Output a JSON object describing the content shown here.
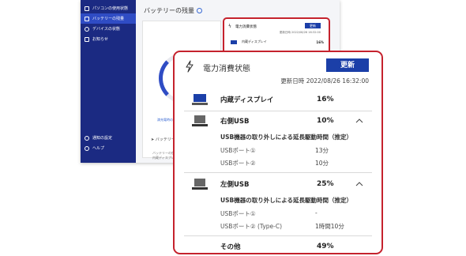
{
  "sidebar": {
    "items": [
      {
        "label": "パソコンの使用状態",
        "icon": "laptop-icon"
      },
      {
        "label": "バッテリーの残量",
        "icon": "battery-icon"
      },
      {
        "label": "デバイスの状態",
        "icon": "gear-icon"
      },
      {
        "label": "お知らせ",
        "icon": "news-icon"
      }
    ],
    "bottom_items": [
      {
        "label": "通知の設定",
        "icon": "settings-icon"
      },
      {
        "label": "ヘルプ",
        "icon": "help-icon"
      }
    ]
  },
  "background": {
    "title": "バッテリーの残量",
    "link": "満充電時の駆動時間",
    "section_title": "バッテリー",
    "rows": [
      "バッテリーの使用",
      "内蔵ディスプレイ"
    ]
  },
  "mini_card": {
    "title": "電力消費状態",
    "refresh_label": "更新",
    "updated": "更新日時 2022/08/26 16:32:00",
    "row_label": "内蔵ディスプレイ",
    "row_value": "16%"
  },
  "panel": {
    "title": "電力消費状態",
    "refresh_label": "更新",
    "updated": "更新日時 2022/08/26 16:32:00",
    "accent_color": "#1b3fa8",
    "highlight_color": "#c5222d",
    "devices": [
      {
        "label": "内蔵ディスプレイ",
        "value": "16%",
        "icon": "monitor-icon"
      },
      {
        "label": "右側USB",
        "value": "10%",
        "icon": "laptop-icon",
        "expanded": true,
        "detail_title": "USB機器の取り外しによる延長駆動時間（推定）",
        "ports": [
          {
            "label": "USBポート①",
            "value": "13分"
          },
          {
            "label": "USBポート②",
            "value": "10分"
          }
        ]
      },
      {
        "label": "左側USB",
        "value": "25%",
        "icon": "laptop-icon",
        "expanded": true,
        "detail_title": "USB機器の取り外しによる延長駆動時間（推定）",
        "ports": [
          {
            "label": "USBポート①",
            "value": "-"
          },
          {
            "label": "USBポート② (Type-C)",
            "value": "1時間10分"
          }
        ]
      },
      {
        "label": "その他",
        "value": "49%"
      }
    ]
  }
}
